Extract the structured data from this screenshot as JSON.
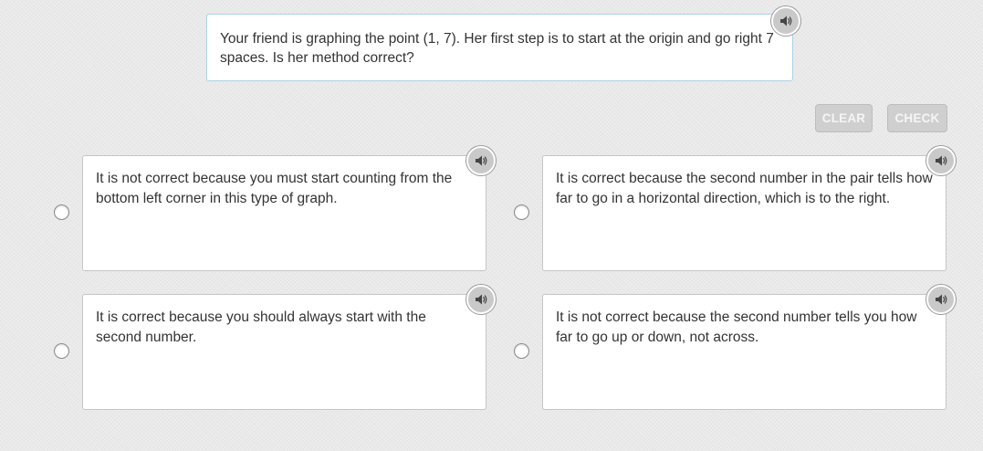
{
  "question": {
    "text": "Your friend is graphing the point (1, 7). Her first step is to start at the origin and go right 7 spaces. Is her method correct?",
    "audio_icon": "speaker-icon"
  },
  "controls": {
    "clear_label": "CLEAR",
    "check_label": "CHECK",
    "enabled": false
  },
  "options": [
    {
      "text": "It is not correct because you must start counting from the bottom left corner in this type of graph.",
      "selected": false
    },
    {
      "text": "It is correct because the second number in the pair tells how far to go in a horizontal direction, which is to the right.",
      "selected": false
    },
    {
      "text": "It is correct because you should always start with the second number.",
      "selected": false
    },
    {
      "text": "It is not correct because the second number tells you how far to go up or down, not across.",
      "selected": false
    }
  ],
  "colors": {
    "background": "#e9e9e9",
    "question_border": "#a9d3e3",
    "button_disabled": "#cfcfcf",
    "text": "#333333"
  }
}
